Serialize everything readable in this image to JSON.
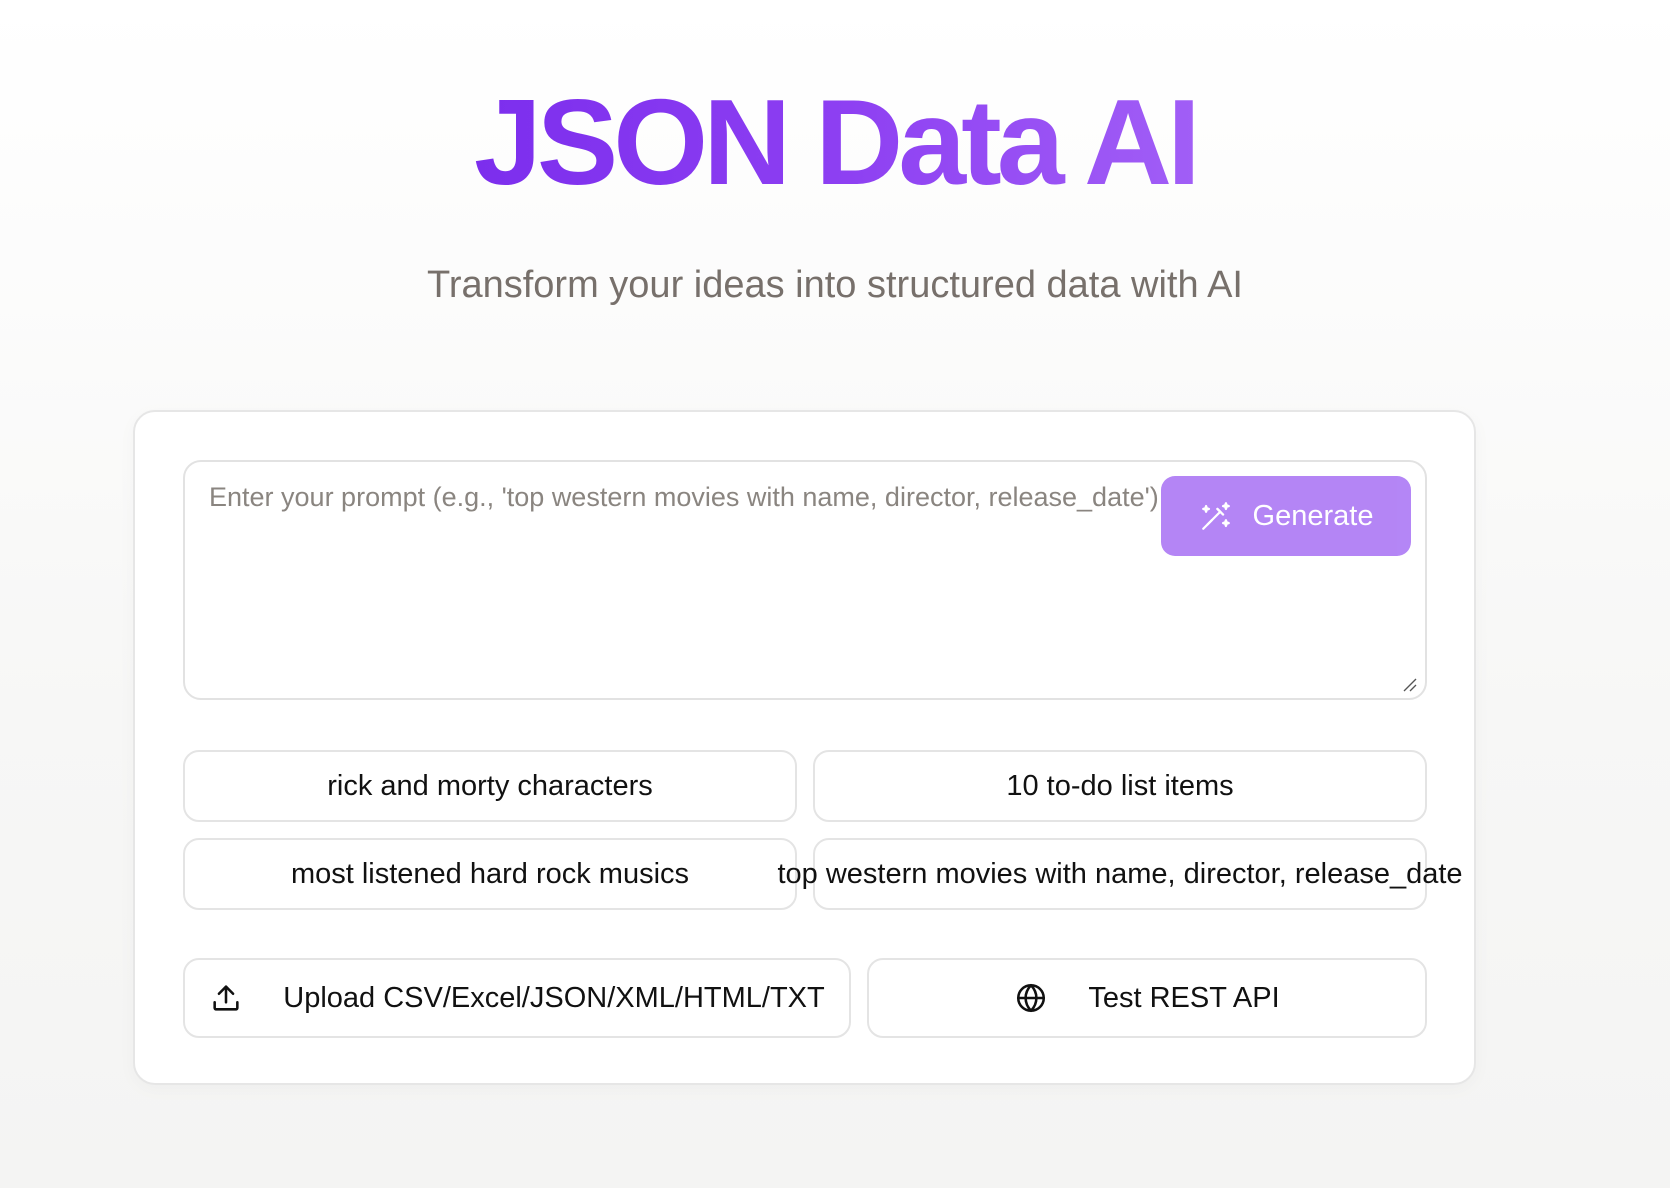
{
  "header": {
    "title": "JSON Data AI",
    "subtitle": "Transform your ideas into structured data with AI"
  },
  "prompt": {
    "placeholder": "Enter your prompt (e.g., 'top western movies with name, director, release_date')",
    "value": ""
  },
  "generate": {
    "label": "Generate",
    "icon": "magic-wand-icon"
  },
  "suggestions": [
    {
      "label": "rick and morty characters"
    },
    {
      "label": "10 to-do list items"
    },
    {
      "label": "most listened hard rock musics"
    },
    {
      "label": "top western movies with name, director, release_date"
    }
  ],
  "actions": {
    "upload": {
      "label": "Upload CSV/Excel/JSON/XML/HTML/TXT",
      "icon": "upload-icon"
    },
    "api": {
      "label": "Test REST API",
      "icon": "globe-icon"
    }
  },
  "colors": {
    "accent": "#8b3cf1",
    "accent_light": "#b07ff5",
    "subtitle": "#77706b"
  }
}
